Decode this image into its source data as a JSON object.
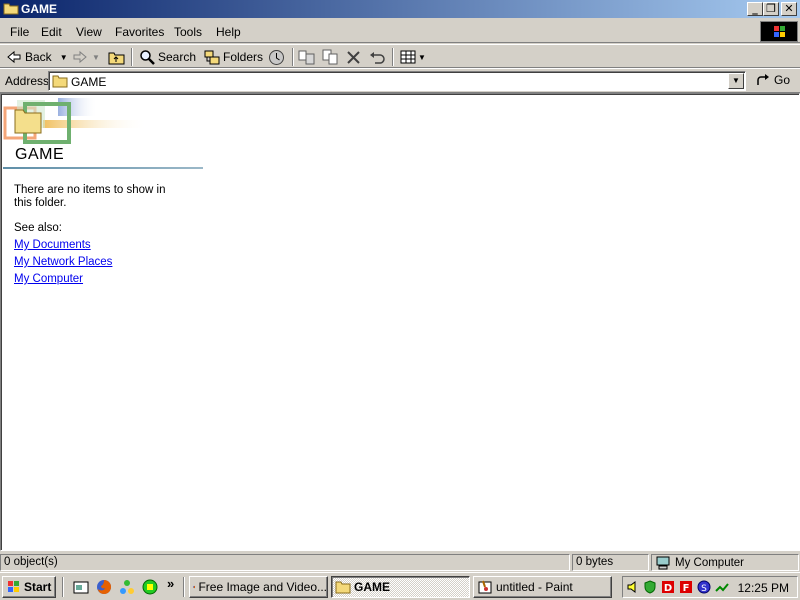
{
  "window": {
    "title": "GAME"
  },
  "menu": {
    "items": [
      {
        "label": "File"
      },
      {
        "label": "Edit"
      },
      {
        "label": "View"
      },
      {
        "label": "Favorites"
      },
      {
        "label": "Tools"
      },
      {
        "label": "Help"
      }
    ]
  },
  "toolbar": {
    "back_label": "Back",
    "search_label": "Search",
    "folders_label": "Folders"
  },
  "address": {
    "label": "Address",
    "value": "GAME",
    "go_label": "Go"
  },
  "content": {
    "folder_title": "GAME",
    "empty_message": "There are no items to show in this folder.",
    "see_also_label": "See also:",
    "links": [
      {
        "label": "My Documents"
      },
      {
        "label": "My Network Places"
      },
      {
        "label": "My Computer"
      }
    ]
  },
  "status": {
    "objects": "0 object(s)",
    "size": "0 bytes",
    "zone": "My Computer"
  },
  "taskbar": {
    "start_label": "Start",
    "overflow": "»",
    "tasks": [
      {
        "label": "Free Image and Video...",
        "active": false
      },
      {
        "label": "GAME",
        "active": true
      },
      {
        "label": "untitled - Paint",
        "active": false
      }
    ],
    "clock": "12:25 PM"
  },
  "colors": {
    "titlebar_start": "#0a246a",
    "titlebar_end": "#a6caf0",
    "link": "#0000ee",
    "face": "#d4d0c8"
  }
}
